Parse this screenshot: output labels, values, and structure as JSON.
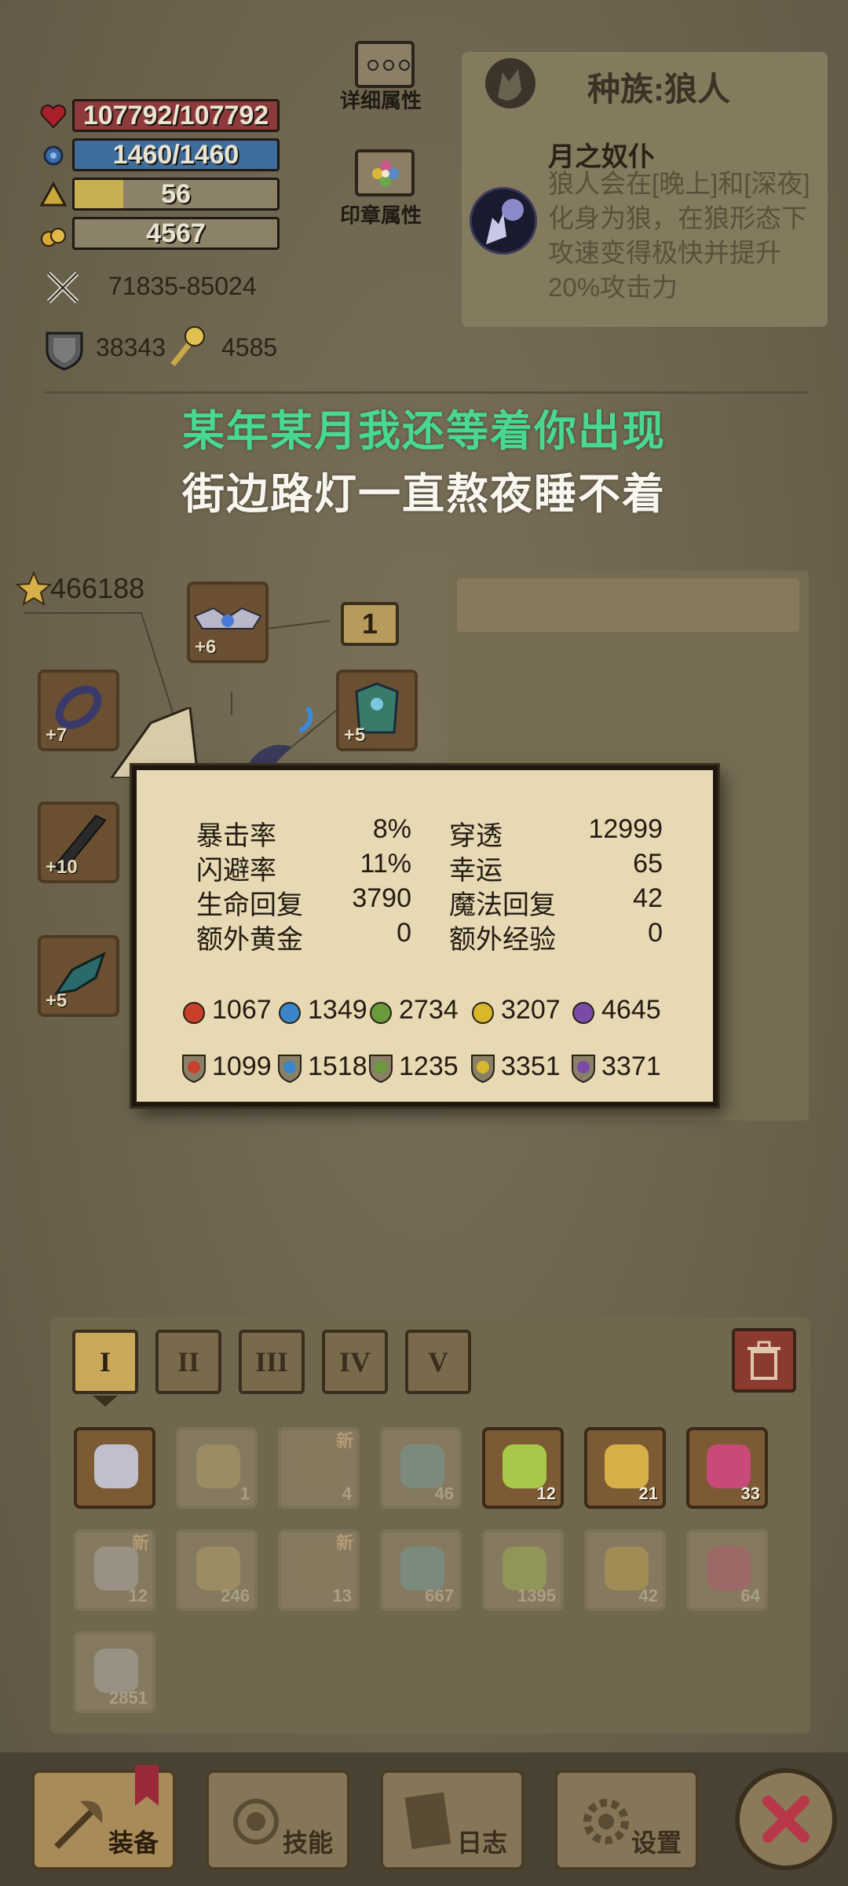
{
  "character": {
    "hp": "107792/107792",
    "mp": "1460/1460",
    "level": "56",
    "gold": "4567",
    "attack": "71835-85024",
    "defense": "38343",
    "magic_power": "4585",
    "score": "466188"
  },
  "side_buttons": {
    "detail_label": "详细属性",
    "seal_label": "印章属性"
  },
  "race_panel": {
    "title": "种族:狼人",
    "trait_name": "月之奴仆",
    "trait_desc": "狼人会在[晚上]和[深夜]化身为狼，在狼形态下攻速变得极快并提升20%攻击力"
  },
  "lyrics": {
    "line1": "某年某月我还等着你出现",
    "line2": "街边路灯一直熬夜睡不着"
  },
  "equipment": {
    "helmet_plus": "+6",
    "left1_plus": "+7",
    "left2_plus": "+10",
    "left3_plus": "+5",
    "right1_plus": "+5",
    "slot_number": "1"
  },
  "attributes": {
    "crit_label": "暴击率",
    "crit_value": "8%",
    "pierce_label": "穿透",
    "pierce_value": "12999",
    "dodge_label": "闪避率",
    "dodge_value": "11%",
    "luck_label": "幸运",
    "luck_value": "65",
    "hp_regen_label": "生命回复",
    "hp_regen_value": "3790",
    "mp_regen_label": "魔法回复",
    "mp_regen_value": "42",
    "extra_gold_label": "额外黄金",
    "extra_gold_value": "0",
    "extra_exp_label": "额外经验",
    "extra_exp_value": "0"
  },
  "elements": {
    "attack": [
      "1067",
      "1349",
      "2734",
      "3207",
      "4645"
    ],
    "resist": [
      "1099",
      "1518",
      "1235",
      "3351",
      "3371"
    ],
    "colors": [
      "#c8402a",
      "#3a86c8",
      "#6a9a3a",
      "#d8b82a",
      "#7a4aa8"
    ]
  },
  "inventory": {
    "tabs": [
      "I",
      "II",
      "III",
      "IV",
      "V"
    ],
    "new_label": "新",
    "row1_counts": [
      "",
      "1",
      "4",
      "46",
      "12",
      "21",
      "33"
    ],
    "row2_counts": [
      "12",
      "246",
      "13",
      "667",
      "1395",
      "42",
      "64"
    ],
    "row3_counts": [
      "2851"
    ]
  },
  "nav": {
    "equip": "装备",
    "skills": "技能",
    "log": "日志",
    "settings": "设置"
  }
}
